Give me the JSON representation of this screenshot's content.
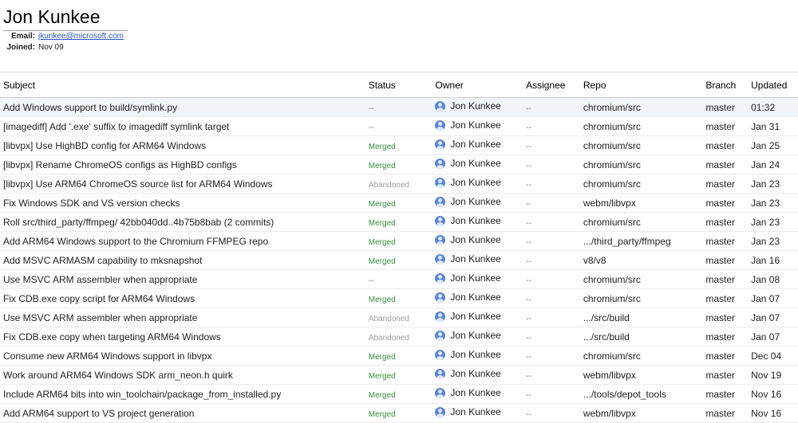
{
  "profile": {
    "name": "Jon Kunkee",
    "email_label": "Email:",
    "email": "jkunkee@microsoft.com",
    "joined_label": "Joined:",
    "joined": "Nov 09"
  },
  "table": {
    "headers": {
      "subject": "Subject",
      "status": "Status",
      "owner": "Owner",
      "assignee": "Assignee",
      "repo": "Repo",
      "branch": "Branch",
      "updated": "Updated"
    },
    "rows": [
      {
        "subject": "Add Windows support to build/symlink.py",
        "status": "--",
        "status_type": "none",
        "owner": "Jon Kunkee",
        "assignee": "--",
        "repo": "chromium/src",
        "branch": "master",
        "updated": "01:32"
      },
      {
        "subject": "[imagediff] Add '.exe' suffix to imagediff symlink target",
        "status": "--",
        "status_type": "none",
        "owner": "Jon Kunkee",
        "assignee": "--",
        "repo": "chromium/src",
        "branch": "master",
        "updated": "Jan 31"
      },
      {
        "subject": "[libvpx] Use HighBD config for ARM64 Windows",
        "status": "Merged",
        "status_type": "merged",
        "owner": "Jon Kunkee",
        "assignee": "--",
        "repo": "chromium/src",
        "branch": "master",
        "updated": "Jan 25"
      },
      {
        "subject": "[libvpx] Rename ChromeOS configs as HighBD configs",
        "status": "Merged",
        "status_type": "merged",
        "owner": "Jon Kunkee",
        "assignee": "--",
        "repo": "chromium/src",
        "branch": "master",
        "updated": "Jan 24"
      },
      {
        "subject": "[libvpx] Use ARM64 ChromeOS source list for ARM64 Windows",
        "status": "Abandoned",
        "status_type": "abandoned",
        "owner": "Jon Kunkee",
        "assignee": "--",
        "repo": "chromium/src",
        "branch": "master",
        "updated": "Jan 23"
      },
      {
        "subject": "Fix Windows SDK and VS version checks",
        "status": "Merged",
        "status_type": "merged",
        "owner": "Jon Kunkee",
        "assignee": "--",
        "repo": "webm/libvpx",
        "branch": "master",
        "updated": "Jan 23"
      },
      {
        "subject": "Roll src/third_party/ffmpeg/ 42bb040dd..4b75b8bab (2 commits)",
        "status": "Merged",
        "status_type": "merged",
        "owner": "Jon Kunkee",
        "assignee": "--",
        "repo": "chromium/src",
        "branch": "master",
        "updated": "Jan 23"
      },
      {
        "subject": "Add ARM64 Windows support to the Chromium FFMPEG repo",
        "status": "Merged",
        "status_type": "merged",
        "owner": "Jon Kunkee",
        "assignee": "--",
        "repo": ".../third_party/ffmpeg",
        "branch": "master",
        "updated": "Jan 23"
      },
      {
        "subject": "Add MSVC ARMASM capability to mksnapshot",
        "status": "Merged",
        "status_type": "merged",
        "owner": "Jon Kunkee",
        "assignee": "--",
        "repo": "v8/v8",
        "branch": "master",
        "updated": "Jan 16"
      },
      {
        "subject": "Use MSVC ARM assembler when appropriate",
        "status": "--",
        "status_type": "none",
        "owner": "Jon Kunkee",
        "assignee": "--",
        "repo": "chromium/src",
        "branch": "master",
        "updated": "Jan 08"
      },
      {
        "subject": "Fix CDB.exe copy script for ARM64 Windows",
        "status": "Merged",
        "status_type": "merged",
        "owner": "Jon Kunkee",
        "assignee": "--",
        "repo": "chromium/src",
        "branch": "master",
        "updated": "Jan 07"
      },
      {
        "subject": "Use MSVC ARM assembler when appropriate",
        "status": "Abandoned",
        "status_type": "abandoned",
        "owner": "Jon Kunkee",
        "assignee": "--",
        "repo": ".../src/build",
        "branch": "master",
        "updated": "Jan 07"
      },
      {
        "subject": "Fix CDB.exe copy when targeting ARM64 Windows",
        "status": "Abandoned",
        "status_type": "abandoned",
        "owner": "Jon Kunkee",
        "assignee": "--",
        "repo": ".../src/build",
        "branch": "master",
        "updated": "Jan 07"
      },
      {
        "subject": "Consume new ARM64 Windows support in libvpx",
        "status": "Merged",
        "status_type": "merged",
        "owner": "Jon Kunkee",
        "assignee": "--",
        "repo": "chromium/src",
        "branch": "master",
        "updated": "Dec 04"
      },
      {
        "subject": "Work around ARM64 Windows SDK arm_neon.h quirk",
        "status": "Merged",
        "status_type": "merged",
        "owner": "Jon Kunkee",
        "assignee": "--",
        "repo": "webm/libvpx",
        "branch": "master",
        "updated": "Nov 19"
      },
      {
        "subject": "Include ARM64 bits into win_toolchain/package_from_installed.py",
        "status": "Merged",
        "status_type": "merged",
        "owner": "Jon Kunkee",
        "assignee": "--",
        "repo": ".../tools/depot_tools",
        "branch": "master",
        "updated": "Nov 16"
      },
      {
        "subject": "Add ARM64 support to VS project generation",
        "status": "Merged",
        "status_type": "merged",
        "owner": "Jon Kunkee",
        "assignee": "--",
        "repo": "webm/libvpx",
        "branch": "master",
        "updated": "Nov 16"
      }
    ]
  },
  "colors": {
    "merged": "#388e3c",
    "abandoned": "#9e9e9e",
    "link": "#2a56c6",
    "avatar": "#5c85d6",
    "highlight_row": "#f1f4f9"
  },
  "icons": {
    "avatar": "account-avatar-icon"
  }
}
